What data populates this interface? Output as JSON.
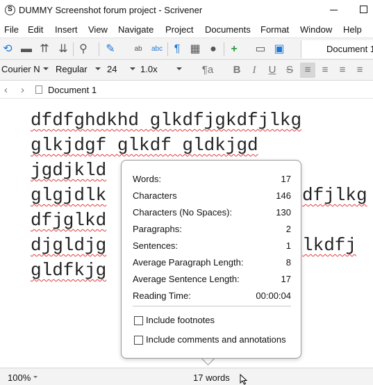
{
  "window": {
    "title": "DUMMY Screenshot forum project - Scrivener",
    "app_logo": "S"
  },
  "menu": [
    "File",
    "Edit",
    "Insert",
    "View",
    "Navigate",
    "Project",
    "Documents",
    "Format",
    "Window",
    "Help"
  ],
  "toolbar": {
    "document_title": "Document 1"
  },
  "format": {
    "font": "Courier N",
    "style": "Regular",
    "size": "24",
    "line_spacing": "1.0x"
  },
  "nav": {
    "document": "Document 1"
  },
  "editor": {
    "lines": [
      "dfdfghdkhd glkdfjgkdfjlkg",
      "glkjdgf glkdf gldkjgd",
      "jgdjkld",
      "glgjdlk",
      "dfjglkd",
      "djgldjg",
      "gldfkjg"
    ],
    "line_tails": [
      "",
      "",
      "",
      "dfjlkg",
      "",
      "lkdfj",
      ""
    ]
  },
  "stats": {
    "rows": [
      {
        "label": "Words:",
        "value": "17"
      },
      {
        "label": "Characters",
        "value": "146"
      },
      {
        "label": "Characters (No Spaces):",
        "value": "130"
      },
      {
        "label": "Paragraphs:",
        "value": "2"
      },
      {
        "label": "Sentences:",
        "value": "1"
      },
      {
        "label": "Average Paragraph Length:",
        "value": "8"
      },
      {
        "label": "Average Sentence Length:",
        "value": "17"
      },
      {
        "label": "Reading Time:",
        "value": "00:00:04"
      }
    ],
    "include_footnotes": "Include footnotes",
    "include_comments": "Include comments and annotations"
  },
  "status": {
    "zoom": "100%",
    "word_count": "17 words"
  },
  "colors": {
    "toolbar_bg": "#f3f3f3",
    "spell_underline": "#e03a3a",
    "accent_green": "#2a9d3a",
    "accent_blue": "#1e78d7"
  }
}
